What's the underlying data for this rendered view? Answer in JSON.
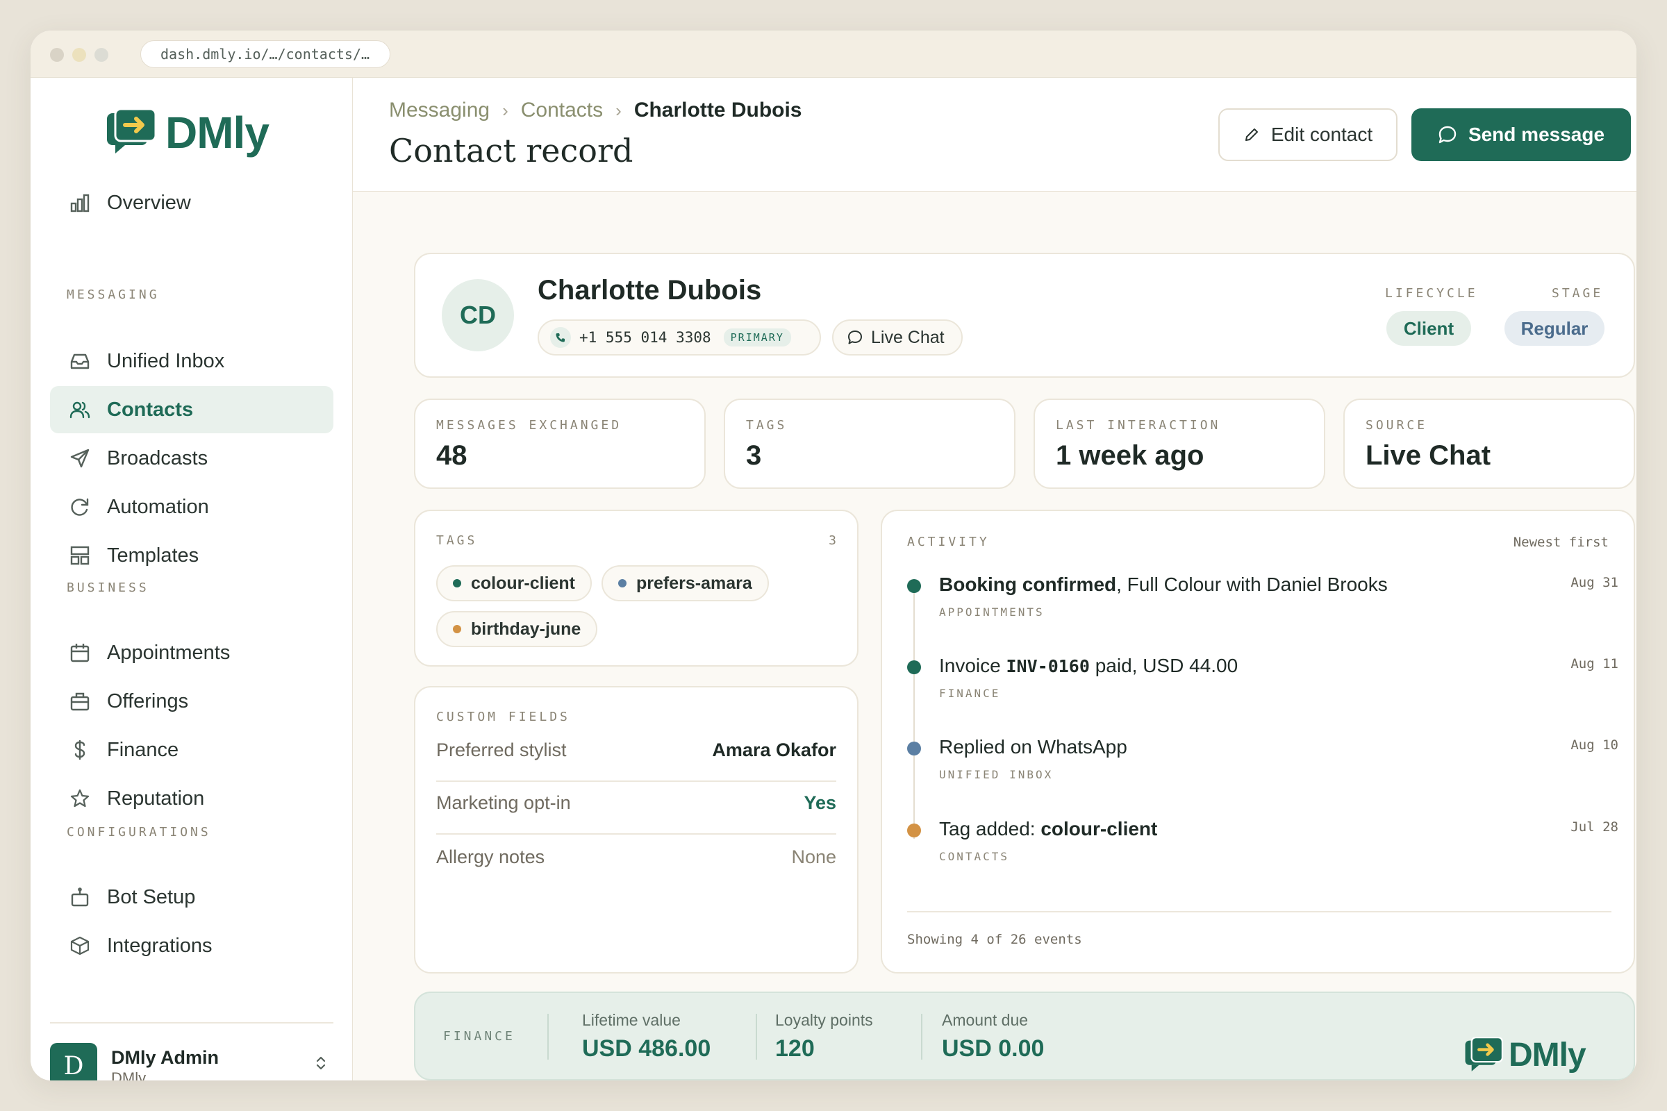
{
  "browser": {
    "url": "dash.dmly.io/…/contacts/…"
  },
  "brand": {
    "name": "DMly",
    "accent": "#1f6b57",
    "icon": "chat-arrow-logo-icon"
  },
  "sidebar": {
    "overview": {
      "label": "Overview",
      "icon": "bar-chart-icon"
    },
    "sections": {
      "messaging": "MESSAGING",
      "business": "BUSINESS",
      "configurations": "CONFIGURATIONS"
    },
    "messaging_items": [
      {
        "label": "Unified Inbox",
        "icon": "inbox-icon",
        "active": false
      },
      {
        "label": "Contacts",
        "icon": "users-icon",
        "active": true
      },
      {
        "label": "Broadcasts",
        "icon": "send-icon",
        "active": false
      },
      {
        "label": "Automation",
        "icon": "refresh-icon",
        "active": false
      },
      {
        "label": "Templates",
        "icon": "layout-icon",
        "active": false
      }
    ],
    "business_items": [
      {
        "label": "Appointments",
        "icon": "calendar-icon"
      },
      {
        "label": "Offerings",
        "icon": "briefcase-icon"
      },
      {
        "label": "Finance",
        "icon": "dollar-icon"
      },
      {
        "label": "Reputation",
        "icon": "star-icon"
      }
    ],
    "config_items": [
      {
        "label": "Bot Setup",
        "icon": "bot-icon"
      },
      {
        "label": "Integrations",
        "icon": "cube-icon"
      }
    ],
    "user": {
      "initial": "D",
      "name": "DMly Admin",
      "org": "DMly"
    }
  },
  "header": {
    "breadcrumb": [
      "Messaging",
      "Contacts",
      "Charlotte Dubois"
    ],
    "title": "Contact record",
    "edit_label": "Edit contact",
    "send_label": "Send message"
  },
  "contact": {
    "initials": "CD",
    "name": "Charlotte Dubois",
    "phone": "+1 555 014 3308",
    "phone_badge": "PRIMARY",
    "channel": "Live Chat",
    "lifecycle_label": "LIFECYCLE",
    "lifecycle_value": "Client",
    "stage_label": "STAGE",
    "stage_value": "Regular"
  },
  "stats": [
    {
      "label": "MESSAGES EXCHANGED",
      "value": "48"
    },
    {
      "label": "TAGS",
      "value": "3"
    },
    {
      "label": "LAST INTERACTION",
      "value": "1 week ago"
    },
    {
      "label": "SOURCE",
      "value": "Live Chat"
    }
  ],
  "tags": {
    "title": "TAGS",
    "count": "3",
    "items": [
      {
        "label": "colour-client",
        "color": "#1f6b57"
      },
      {
        "label": "prefers-amara",
        "color": "#5b7fa3"
      },
      {
        "label": "birthday-june",
        "color": "#d39244"
      }
    ]
  },
  "custom_fields": {
    "title": "CUSTOM FIELDS",
    "rows": [
      {
        "key": "Preferred stylist",
        "value": "Amara Okafor"
      },
      {
        "key": "Marketing opt-in",
        "value": "Yes"
      },
      {
        "key": "Allergy notes",
        "value": "None"
      }
    ]
  },
  "activity": {
    "title": "ACTIVITY",
    "sort": "Newest first",
    "items": [
      {
        "bold": "Booking confirmed",
        "rest": ", Full Colour with Daniel Brooks",
        "category": "APPOINTMENTS",
        "date": "Aug 31",
        "color": "#1f6b57"
      },
      {
        "pre": "Invoice ",
        "code": "INV-0160",
        "rest": " paid, USD 44.00",
        "category": "FINANCE",
        "date": "Aug 11",
        "color": "#1f6b57"
      },
      {
        "text": "Replied on WhatsApp",
        "category": "UNIFIED INBOX",
        "date": "Aug 10",
        "color": "#5b7fa3"
      },
      {
        "pre": "Tag added: ",
        "bold": "colour-client",
        "category": "CONTACTS",
        "date": "Jul 28",
        "color": "#d39244"
      }
    ],
    "footer": "Showing 4 of 26 events"
  },
  "finance": {
    "label": "FINANCE",
    "items": [
      {
        "key": "Lifetime value",
        "value": "USD 486.00"
      },
      {
        "key": "Loyalty points",
        "value": "120"
      },
      {
        "key": "Amount due",
        "value": "USD 0.00"
      }
    ]
  }
}
